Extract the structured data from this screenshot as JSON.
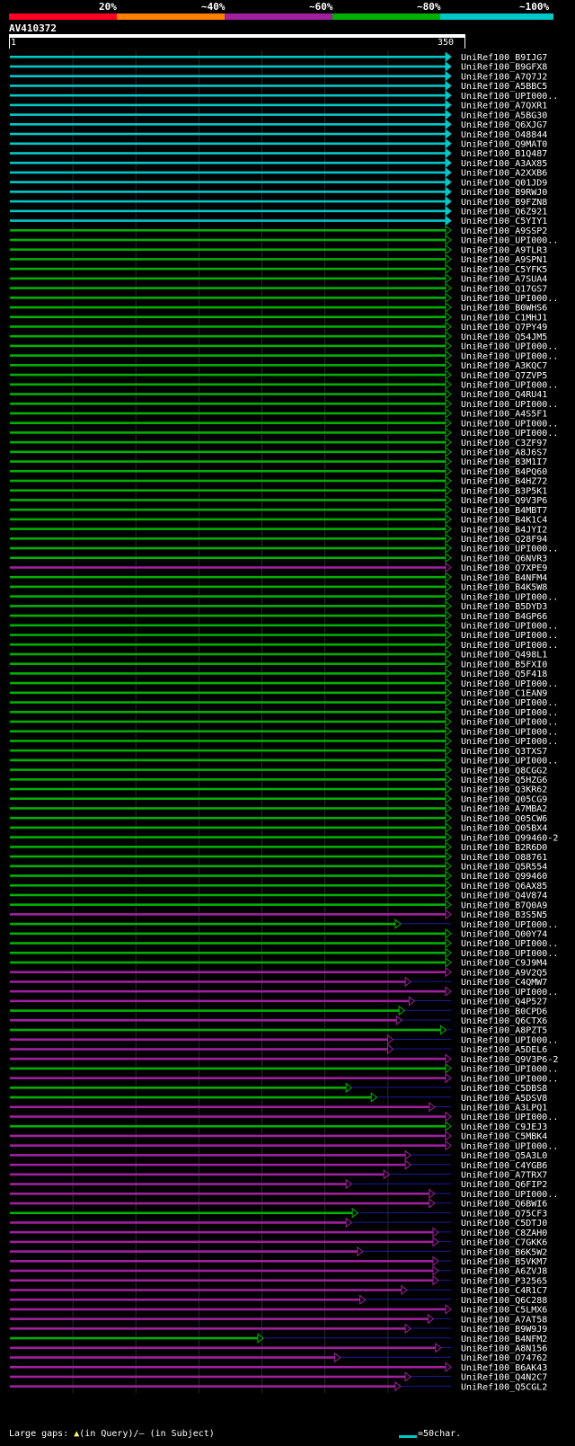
{
  "legend": {
    "labels": [
      "20%",
      "~40%",
      "~60%",
      "~80%",
      "~100%"
    ],
    "colors": [
      "#ff0022",
      "#ff7f00",
      "#a020a0",
      "#00b000",
      "#00c8c8"
    ]
  },
  "query": {
    "name": "AV410372",
    "start_label": "1",
    "end_label": "350",
    "length": 350
  },
  "footer": {
    "prefix": "Large gaps: ",
    "query_marker": "▲",
    "in_query": "(in Query)/",
    "subject_marker": "–",
    "in_subject": " (in Subject)",
    "scale_label": "=50char."
  },
  "chart_data": {
    "type": "alignment-overview",
    "query_length": 350,
    "identity_bins": [
      "20%",
      "~40%",
      "~60%",
      "~80%",
      "~100%"
    ],
    "hits": [
      {
        "name": "UniRef100_B9IJG7",
        "bin": "~100%",
        "end": 350
      },
      {
        "name": "UniRef100_B9GFX8",
        "bin": "~100%",
        "end": 350
      },
      {
        "name": "UniRef100_A7Q7J2",
        "bin": "~100%",
        "end": 350
      },
      {
        "name": "UniRef100_A5BBC5",
        "bin": "~100%",
        "end": 350
      },
      {
        "name": "UniRef100_UPI000..",
        "bin": "~100%",
        "end": 350
      },
      {
        "name": "UniRef100_A7QXR1",
        "bin": "~100%",
        "end": 350
      },
      {
        "name": "UniRef100_A5BG30",
        "bin": "~100%",
        "end": 350
      },
      {
        "name": "UniRef100_Q6XJG7",
        "bin": "~100%",
        "end": 350
      },
      {
        "name": "UniRef100_O48844",
        "bin": "~100%",
        "end": 350
      },
      {
        "name": "UniRef100_Q9MAT0",
        "bin": "~100%",
        "end": 350
      },
      {
        "name": "UniRef100_B1Q487",
        "bin": "~100%",
        "end": 350
      },
      {
        "name": "UniRef100_A3AX85",
        "bin": "~100%",
        "end": 350
      },
      {
        "name": "UniRef100_A2XXB6",
        "bin": "~100%",
        "end": 350
      },
      {
        "name": "UniRef100_Q01JD9",
        "bin": "~100%",
        "end": 350
      },
      {
        "name": "UniRef100_B9RWJ0",
        "bin": "~100%",
        "end": 350
      },
      {
        "name": "UniRef100_B9FZN8",
        "bin": "~100%",
        "end": 350
      },
      {
        "name": "UniRef100_Q6Z921",
        "bin": "~100%",
        "end": 350
      },
      {
        "name": "UniRef100_C5YIY1",
        "bin": "~100%",
        "end": 350
      },
      {
        "name": "UniRef100_A9SSP2",
        "bin": "~80%",
        "end": 350
      },
      {
        "name": "UniRef100_UPI000..",
        "bin": "~80%",
        "end": 350
      },
      {
        "name": "UniRef100_A9TLR3",
        "bin": "~80%",
        "end": 350
      },
      {
        "name": "UniRef100_A9SPN1",
        "bin": "~80%",
        "end": 350
      },
      {
        "name": "UniRef100_C5YFK5",
        "bin": "~80%",
        "end": 350
      },
      {
        "name": "UniRef100_A7SUA4",
        "bin": "~80%",
        "end": 350
      },
      {
        "name": "UniRef100_Q17GS7",
        "bin": "~80%",
        "end": 350
      },
      {
        "name": "UniRef100_UPI000..",
        "bin": "~80%",
        "end": 350
      },
      {
        "name": "UniRef100_B0WHS6",
        "bin": "~80%",
        "end": 350
      },
      {
        "name": "UniRef100_C1MHJ1",
        "bin": "~80%",
        "end": 350
      },
      {
        "name": "UniRef100_Q7PY49",
        "bin": "~80%",
        "end": 350
      },
      {
        "name": "UniRef100_Q54JM5",
        "bin": "~80%",
        "end": 350
      },
      {
        "name": "UniRef100_UPI000..",
        "bin": "~80%",
        "end": 350
      },
      {
        "name": "UniRef100_UPI000..",
        "bin": "~80%",
        "end": 350
      },
      {
        "name": "UniRef100_A3KQC7",
        "bin": "~80%",
        "end": 350
      },
      {
        "name": "UniRef100_Q7ZVP5",
        "bin": "~80%",
        "end": 350
      },
      {
        "name": "UniRef100_UPI000..",
        "bin": "~80%",
        "end": 350
      },
      {
        "name": "UniRef100_Q4RU41",
        "bin": "~80%",
        "end": 350
      },
      {
        "name": "UniRef100_UPI000..",
        "bin": "~80%",
        "end": 350
      },
      {
        "name": "UniRef100_A4S5F1",
        "bin": "~80%",
        "end": 350
      },
      {
        "name": "UniRef100_UPI000..",
        "bin": "~80%",
        "end": 350
      },
      {
        "name": "UniRef100_UPI000..",
        "bin": "~80%",
        "end": 350
      },
      {
        "name": "UniRef100_C3ZF97",
        "bin": "~80%",
        "end": 350
      },
      {
        "name": "UniRef100_A8J6S7",
        "bin": "~80%",
        "end": 350
      },
      {
        "name": "UniRef100_B3M1I7",
        "bin": "~80%",
        "end": 350
      },
      {
        "name": "UniRef100_B4PQ60",
        "bin": "~80%",
        "end": 350
      },
      {
        "name": "UniRef100_B4HZ72",
        "bin": "~80%",
        "end": 350
      },
      {
        "name": "UniRef100_B3P5K1",
        "bin": "~80%",
        "end": 350
      },
      {
        "name": "UniRef100_Q9V3P6",
        "bin": "~80%",
        "end": 350
      },
      {
        "name": "UniRef100_B4MBT7",
        "bin": "~80%",
        "end": 350
      },
      {
        "name": "UniRef100_B4K1C4",
        "bin": "~80%",
        "end": 350
      },
      {
        "name": "UniRef100_B4JYI2",
        "bin": "~80%",
        "end": 350
      },
      {
        "name": "UniRef100_Q28F94",
        "bin": "~80%",
        "end": 350
      },
      {
        "name": "UniRef100_UPI000..",
        "bin": "~80%",
        "end": 350
      },
      {
        "name": "UniRef100_Q6NVR3",
        "bin": "~80%",
        "end": 350
      },
      {
        "name": "UniRef100_Q7XPE9",
        "bin": "~60%",
        "end": 350
      },
      {
        "name": "UniRef100_B4NFM4",
        "bin": "~80%",
        "end": 350
      },
      {
        "name": "UniRef100_B4K5W8",
        "bin": "~80%",
        "end": 350
      },
      {
        "name": "UniRef100_UPI000..",
        "bin": "~80%",
        "end": 350
      },
      {
        "name": "UniRef100_B5DYD3",
        "bin": "~80%",
        "end": 350
      },
      {
        "name": "UniRef100_B4GP66",
        "bin": "~80%",
        "end": 350
      },
      {
        "name": "UniRef100_UPI000..",
        "bin": "~80%",
        "end": 350
      },
      {
        "name": "UniRef100_UPI000..",
        "bin": "~80%",
        "end": 350
      },
      {
        "name": "UniRef100_UPI000..",
        "bin": "~80%",
        "end": 350
      },
      {
        "name": "UniRef100_Q498L1",
        "bin": "~80%",
        "end": 350
      },
      {
        "name": "UniRef100_B5FXI0",
        "bin": "~80%",
        "end": 350
      },
      {
        "name": "UniRef100_Q5F418",
        "bin": "~80%",
        "end": 350
      },
      {
        "name": "UniRef100_UPI000..",
        "bin": "~80%",
        "end": 350
      },
      {
        "name": "UniRef100_C1EAN9",
        "bin": "~80%",
        "end": 350
      },
      {
        "name": "UniRef100_UPI000..",
        "bin": "~80%",
        "end": 350
      },
      {
        "name": "UniRef100_UPI000..",
        "bin": "~80%",
        "end": 350
      },
      {
        "name": "UniRef100_UPI000..",
        "bin": "~80%",
        "end": 350
      },
      {
        "name": "UniRef100_UPI000..",
        "bin": "~80%",
        "end": 350
      },
      {
        "name": "UniRef100_UPI000..",
        "bin": "~80%",
        "end": 350
      },
      {
        "name": "UniRef100_Q3TXS7",
        "bin": "~80%",
        "end": 350
      },
      {
        "name": "UniRef100_UPI000..",
        "bin": "~80%",
        "end": 350
      },
      {
        "name": "UniRef100_Q8CGG2",
        "bin": "~80%",
        "end": 350
      },
      {
        "name": "UniRef100_Q5HZG6",
        "bin": "~80%",
        "end": 350
      },
      {
        "name": "UniRef100_Q3KR62",
        "bin": "~80%",
        "end": 350
      },
      {
        "name": "UniRef100_Q05CG9",
        "bin": "~80%",
        "end": 350
      },
      {
        "name": "UniRef100_A7MBA2",
        "bin": "~80%",
        "end": 350
      },
      {
        "name": "UniRef100_Q05CW6",
        "bin": "~80%",
        "end": 350
      },
      {
        "name": "UniRef100_Q05BX4",
        "bin": "~80%",
        "end": 350
      },
      {
        "name": "UniRef100_Q99460-2",
        "bin": "~80%",
        "end": 350
      },
      {
        "name": "UniRef100_B2R6D0",
        "bin": "~80%",
        "end": 350
      },
      {
        "name": "UniRef100_O88761",
        "bin": "~80%",
        "end": 350
      },
      {
        "name": "UniRef100_Q5R554",
        "bin": "~80%",
        "end": 350
      },
      {
        "name": "UniRef100_Q99460",
        "bin": "~80%",
        "end": 350
      },
      {
        "name": "UniRef100_Q6AX85",
        "bin": "~80%",
        "end": 350
      },
      {
        "name": "UniRef100_Q4V874",
        "bin": "~80%",
        "end": 350
      },
      {
        "name": "UniRef100_B7Q0A9",
        "bin": "~80%",
        "end": 350
      },
      {
        "name": "UniRef100_B3S5N5",
        "bin": "~60%",
        "end": 350
      },
      {
        "name": "UniRef100_UPI000..",
        "bin": "~80%",
        "end": 310
      },
      {
        "name": "UniRef100_Q00Y74",
        "bin": "~80%",
        "end": 350
      },
      {
        "name": "UniRef100_UPI000..",
        "bin": "~80%",
        "end": 350
      },
      {
        "name": "UniRef100_UPI000..",
        "bin": "~80%",
        "end": 350
      },
      {
        "name": "UniRef100_C9J9M4",
        "bin": "~80%",
        "end": 350
      },
      {
        "name": "UniRef100_A9V2Q5",
        "bin": "~60%",
        "end": 350
      },
      {
        "name": "UniRef100_C4QMW7",
        "bin": "~60%",
        "end": 318
      },
      {
        "name": "UniRef100_UPI000..",
        "bin": "~60%",
        "end": 350
      },
      {
        "name": "UniRef100_Q4P527",
        "bin": "~60%",
        "end": 321
      },
      {
        "name": "UniRef100_B0CPD6",
        "bin": "~80%",
        "end": 313
      },
      {
        "name": "UniRef100_Q6CTX6",
        "bin": "~60%",
        "end": 311
      },
      {
        "name": "UniRef100_A8PZT5",
        "bin": "~80%",
        "end": 346
      },
      {
        "name": "UniRef100_UPI000..",
        "bin": "~60%",
        "end": 304
      },
      {
        "name": "UniRef100_A5DEL6",
        "bin": "~60%",
        "end": 304
      },
      {
        "name": "UniRef100_Q9V3P6-2",
        "bin": "~60%",
        "end": 350
      },
      {
        "name": "UniRef100_UPI000..",
        "bin": "~80%",
        "end": 350
      },
      {
        "name": "UniRef100_UPI000..",
        "bin": "~60%",
        "end": 350
      },
      {
        "name": "UniRef100_C5DBS8",
        "bin": "~80%",
        "end": 271
      },
      {
        "name": "UniRef100_A5DSV8",
        "bin": "~80%",
        "end": 291
      },
      {
        "name": "UniRef100_A3LPQ1",
        "bin": "~60%",
        "end": 337
      },
      {
        "name": "UniRef100_UPI000..",
        "bin": "~60%",
        "end": 350
      },
      {
        "name": "UniRef100_C9JEJ3",
        "bin": "~80%",
        "end": 350
      },
      {
        "name": "UniRef100_C5MBK4",
        "bin": "~60%",
        "end": 350
      },
      {
        "name": "UniRef100_UPI000..",
        "bin": "~60%",
        "end": 350
      },
      {
        "name": "UniRef100_Q5A3L0",
        "bin": "~60%",
        "end": 318
      },
      {
        "name": "UniRef100_C4YGB6",
        "bin": "~60%",
        "end": 318
      },
      {
        "name": "UniRef100_A7TRX7",
        "bin": "~60%",
        "end": 301
      },
      {
        "name": "UniRef100_Q6FIP2",
        "bin": "~60%",
        "end": 271
      },
      {
        "name": "UniRef100_UPI000..",
        "bin": "~60%",
        "end": 337
      },
      {
        "name": "UniRef100_Q6BWI6",
        "bin": "~60%",
        "end": 337
      },
      {
        "name": "UniRef100_Q75CF3",
        "bin": "~80%",
        "end": 276
      },
      {
        "name": "UniRef100_C5DTJ0",
        "bin": "~60%",
        "end": 271
      },
      {
        "name": "UniRef100_C8ZAH0",
        "bin": "~60%",
        "end": 340
      },
      {
        "name": "UniRef100_C7GKK6",
        "bin": "~60%",
        "end": 340
      },
      {
        "name": "UniRef100_B6K5W2",
        "bin": "~60%",
        "end": 280
      },
      {
        "name": "UniRef100_B5VKM7",
        "bin": "~60%",
        "end": 340
      },
      {
        "name": "UniRef100_A6ZVJ8",
        "bin": "~60%",
        "end": 340
      },
      {
        "name": "UniRef100_P32565",
        "bin": "~60%",
        "end": 340
      },
      {
        "name": "UniRef100_C4R1C7",
        "bin": "~60%",
        "end": 315
      },
      {
        "name": "UniRef100_Q6C288",
        "bin": "~60%",
        "end": 282
      },
      {
        "name": "UniRef100_C5LMX6",
        "bin": "~60%",
        "end": 350
      },
      {
        "name": "UniRef100_A7AT58",
        "bin": "~60%",
        "end": 336
      },
      {
        "name": "UniRef100_B9W9J9",
        "bin": "~60%",
        "end": 318
      },
      {
        "name": "UniRef100_B4NFM2",
        "bin": "~80%",
        "end": 201
      },
      {
        "name": "UniRef100_A8N156",
        "bin": "~60%",
        "end": 342
      },
      {
        "name": "UniRef100_O74762",
        "bin": "~60%",
        "end": 262
      },
      {
        "name": "UniRef100_B6AK43",
        "bin": "~60%",
        "end": 350
      },
      {
        "name": "UniRef100_Q4N2C7",
        "bin": "~60%",
        "end": 318
      },
      {
        "name": "UniRef100_Q5CGL2",
        "bin": "~60%",
        "end": 310
      }
    ]
  }
}
